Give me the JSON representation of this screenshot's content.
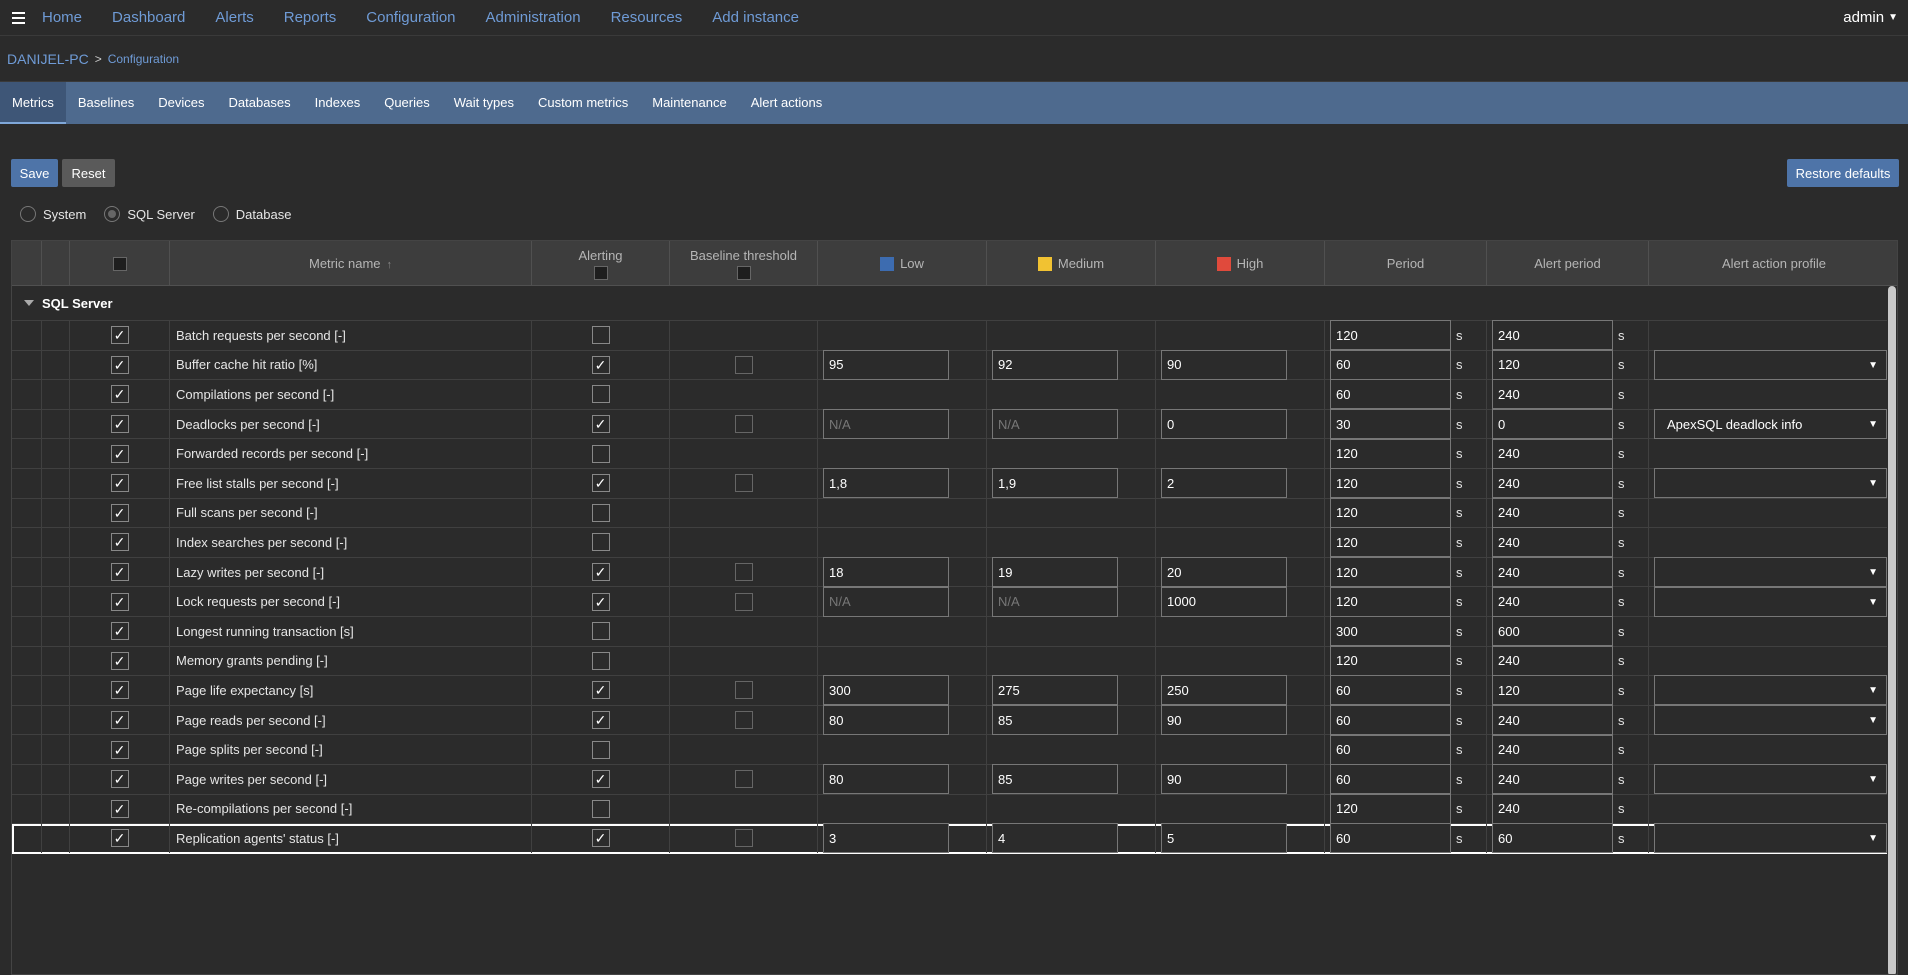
{
  "nav": {
    "links": [
      "Home",
      "Dashboard",
      "Alerts",
      "Reports",
      "Configuration",
      "Administration",
      "Resources",
      "Add instance"
    ],
    "user": "admin"
  },
  "breadcrumb": {
    "host": "DANIJEL-PC",
    "page": "Configuration"
  },
  "tabs": [
    "Metrics",
    "Baselines",
    "Devices",
    "Databases",
    "Indexes",
    "Queries",
    "Wait types",
    "Custom metrics",
    "Maintenance",
    "Alert actions"
  ],
  "active_tab": "Metrics",
  "toolbar": {
    "save": "Save",
    "reset": "Reset",
    "restore": "Restore defaults"
  },
  "scope": {
    "options": [
      "System",
      "SQL Server",
      "Database"
    ],
    "selected": "SQL Server"
  },
  "columns": {
    "metric_name": "Metric name",
    "alerting": "Alerting",
    "baseline": "Baseline threshold",
    "low": "Low",
    "medium": "Medium",
    "high": "High",
    "period": "Period",
    "alert_period": "Alert period",
    "profile": "Alert action profile"
  },
  "colors": {
    "low": "#3d6cb0",
    "medium": "#f1c232",
    "high": "#e04a3c",
    "tab_bar": "#4e6a8e",
    "link": "#6f9bd6"
  },
  "group": "SQL Server",
  "unit": "s",
  "rows": [
    {
      "name": "Batch requests per second [-]",
      "alerting": false,
      "thr": false,
      "low": "",
      "med": "",
      "high": "",
      "period": "120",
      "aperiod": "240",
      "profile": null
    },
    {
      "name": "Buffer cache hit ratio [%]",
      "alerting": true,
      "thr": true,
      "low": "95",
      "med": "92",
      "high": "90",
      "period": "60",
      "aperiod": "120",
      "profile": ""
    },
    {
      "name": "Compilations per second [-]",
      "alerting": false,
      "thr": false,
      "low": "",
      "med": "",
      "high": "",
      "period": "60",
      "aperiod": "240",
      "profile": null
    },
    {
      "name": "Deadlocks per second [-]",
      "alerting": true,
      "thr": true,
      "low": "N/A",
      "med": "N/A",
      "high": "0",
      "period": "30",
      "aperiod": "0",
      "profile": "ApexSQL deadlock info"
    },
    {
      "name": "Forwarded records per second [-]",
      "alerting": false,
      "thr": false,
      "low": "",
      "med": "",
      "high": "",
      "period": "120",
      "aperiod": "240",
      "profile": null
    },
    {
      "name": "Free list stalls per second [-]",
      "alerting": true,
      "thr": true,
      "low": "1,8",
      "med": "1,9",
      "high": "2",
      "period": "120",
      "aperiod": "240",
      "profile": ""
    },
    {
      "name": "Full scans per second [-]",
      "alerting": false,
      "thr": false,
      "low": "",
      "med": "",
      "high": "",
      "period": "120",
      "aperiod": "240",
      "profile": null
    },
    {
      "name": "Index searches per second [-]",
      "alerting": false,
      "thr": false,
      "low": "",
      "med": "",
      "high": "",
      "period": "120",
      "aperiod": "240",
      "profile": null
    },
    {
      "name": "Lazy writes per second [-]",
      "alerting": true,
      "thr": true,
      "low": "18",
      "med": "19",
      "high": "20",
      "period": "120",
      "aperiod": "240",
      "profile": ""
    },
    {
      "name": "Lock requests per second [-]",
      "alerting": true,
      "thr": true,
      "low": "N/A",
      "med": "N/A",
      "high": "1000",
      "period": "120",
      "aperiod": "240",
      "profile": ""
    },
    {
      "name": "Longest running transaction [s]",
      "alerting": false,
      "thr": false,
      "low": "",
      "med": "",
      "high": "",
      "period": "300",
      "aperiod": "600",
      "profile": null
    },
    {
      "name": "Memory grants pending [-]",
      "alerting": false,
      "thr": false,
      "low": "",
      "med": "",
      "high": "",
      "period": "120",
      "aperiod": "240",
      "profile": null
    },
    {
      "name": "Page life expectancy [s]",
      "alerting": true,
      "thr": true,
      "low": "300",
      "med": "275",
      "high": "250",
      "period": "60",
      "aperiod": "120",
      "profile": ""
    },
    {
      "name": "Page reads per second [-]",
      "alerting": true,
      "thr": true,
      "low": "80",
      "med": "85",
      "high": "90",
      "period": "60",
      "aperiod": "240",
      "profile": ""
    },
    {
      "name": "Page splits per second [-]",
      "alerting": false,
      "thr": false,
      "low": "",
      "med": "",
      "high": "",
      "period": "60",
      "aperiod": "240",
      "profile": null
    },
    {
      "name": "Page writes per second [-]",
      "alerting": true,
      "thr": true,
      "low": "80",
      "med": "85",
      "high": "90",
      "period": "60",
      "aperiod": "240",
      "profile": ""
    },
    {
      "name": "Re-compilations per second [-]",
      "alerting": false,
      "thr": false,
      "low": "",
      "med": "",
      "high": "",
      "period": "120",
      "aperiod": "240",
      "profile": null
    },
    {
      "name": "Replication agents' status [-]",
      "alerting": true,
      "thr": true,
      "low": "3",
      "med": "4",
      "high": "5",
      "period": "60",
      "aperiod": "60",
      "profile": "",
      "selected": true
    }
  ]
}
